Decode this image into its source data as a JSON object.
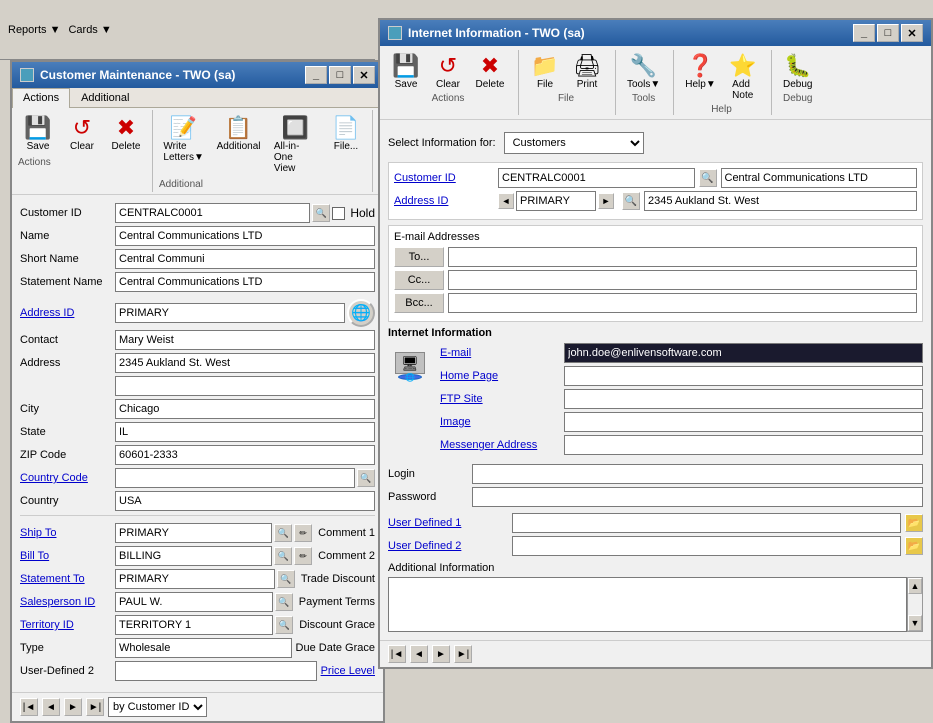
{
  "background": "#d4d0c8",
  "customer_maintenance_window": {
    "title": "Customer Maintenance  -  TWO (sa)",
    "ribbon": {
      "tabs": [
        "Actions",
        "Additional"
      ],
      "active_tab": "Actions",
      "groups": {
        "actions": {
          "label": "Actions",
          "buttons": [
            "Save",
            "Clear",
            "Delete"
          ]
        },
        "additional": {
          "label": "Additional",
          "buttons": [
            "Write Letters",
            "Additional",
            "All-in-One View",
            "File"
          ]
        }
      }
    },
    "form": {
      "customer_id": {
        "label": "Customer ID",
        "value": "CENTRALC0001",
        "has_lookup": true,
        "checkbox_label": "Hold"
      },
      "name": {
        "label": "Name",
        "value": "Central Communications LTD"
      },
      "short_name": {
        "label": "Short Name",
        "value": "Central Communi"
      },
      "statement_name": {
        "label": "Statement Name",
        "value": "Central Communications LTD"
      },
      "address_id": {
        "label": "Address ID",
        "value": "PRIMARY",
        "is_link": true,
        "has_globe": true
      },
      "contact": {
        "label": "Contact",
        "value": "Mary Weist"
      },
      "address": {
        "label": "Address",
        "value": "2345 Aukland St. West"
      },
      "city": {
        "label": "City",
        "value": "Chicago"
      },
      "state": {
        "label": "State",
        "value": "IL"
      },
      "zip_code": {
        "label": "ZIP Code",
        "value": "60601-2333"
      },
      "country_code": {
        "label": "Country Code",
        "value": "",
        "is_link": true,
        "has_lookup": true
      },
      "country": {
        "label": "Country",
        "value": "USA"
      },
      "ship_to": {
        "label": "Ship To",
        "value": "PRIMARY",
        "is_link": true,
        "comment": "Comment 1"
      },
      "bill_to": {
        "label": "Bill To",
        "value": "BILLING",
        "is_link": true,
        "comment": "Comment 2"
      },
      "statement_to": {
        "label": "Statement To",
        "value": "PRIMARY",
        "is_link": true,
        "trade": "Trade Discount"
      },
      "salesperson_id": {
        "label": "Salesperson ID",
        "value": "PAUL W.",
        "is_link": true,
        "payment": "Payment Terms"
      },
      "territory_id": {
        "label": "Territory ID",
        "value": "TERRITORY 1",
        "is_link": true,
        "discount_grace": "Discount Grace"
      },
      "type": {
        "label": "Type",
        "value": "Wholesale",
        "due_date_grace": "Due Date Grace"
      },
      "user_defined_2": {
        "label": "User-Defined 2",
        "value": "",
        "price_level": "Price Level"
      }
    },
    "nav": {
      "by_label": "by Customer ID"
    }
  },
  "internet_info_window": {
    "title": "Internet Information  -  TWO (sa)",
    "ribbon": {
      "groups": {
        "actions": {
          "label": "Actions",
          "buttons": [
            {
              "label": "Save",
              "icon": "💾"
            },
            {
              "label": "Clear",
              "icon": "🔄"
            },
            {
              "label": "Delete",
              "icon": "✖"
            }
          ]
        },
        "file": {
          "label": "File",
          "buttons": [
            {
              "label": "File",
              "icon": "📁"
            },
            {
              "label": "Print",
              "icon": "🖨"
            }
          ]
        },
        "tools": {
          "label": "Tools",
          "buttons": [
            {
              "label": "Tools",
              "icon": "🔧"
            }
          ]
        },
        "help": {
          "label": "Help",
          "buttons": [
            {
              "label": "Help",
              "icon": "❓"
            },
            {
              "label": "Add Note",
              "icon": "⭐"
            }
          ]
        },
        "debug": {
          "label": "Debug",
          "buttons": [
            {
              "label": "Debug",
              "icon": "🐛"
            }
          ]
        }
      }
    },
    "select_info_for": {
      "label": "Select Information for:",
      "value": "Customers",
      "options": [
        "Customers"
      ]
    },
    "customer_id": {
      "label": "Customer ID",
      "value": "CENTRALC0001",
      "company": "Central Communications LTD",
      "is_link": true
    },
    "address_id": {
      "label": "Address ID",
      "value": "PRIMARY",
      "address": "2345 Aukland St. West",
      "is_link": true
    },
    "email_addresses": {
      "label": "E-mail Addresses",
      "to_btn": "To...",
      "cc_btn": "Cc...",
      "bcc_btn": "Bcc..."
    },
    "internet_information": {
      "section_label": "Internet Information",
      "email": {
        "label": "E-mail",
        "value": "john.doe@enlivensoftware.com"
      },
      "home_page": {
        "label": "Home Page",
        "value": ""
      },
      "ftp_site": {
        "label": "FTP Site",
        "value": ""
      },
      "image": {
        "label": "Image",
        "value": ""
      },
      "messenger_address": {
        "label": "Messenger Address",
        "value": ""
      }
    },
    "login": {
      "label": "Login",
      "password_label": "Password",
      "login_value": "",
      "password_value": ""
    },
    "user_defined": {
      "user_defined_1": {
        "label": "User Defined 1",
        "value": ""
      },
      "user_defined_2": {
        "label": "User Defined 2",
        "value": ""
      }
    },
    "additional_information": {
      "label": "Additional Information",
      "value": ""
    },
    "nav": {}
  }
}
